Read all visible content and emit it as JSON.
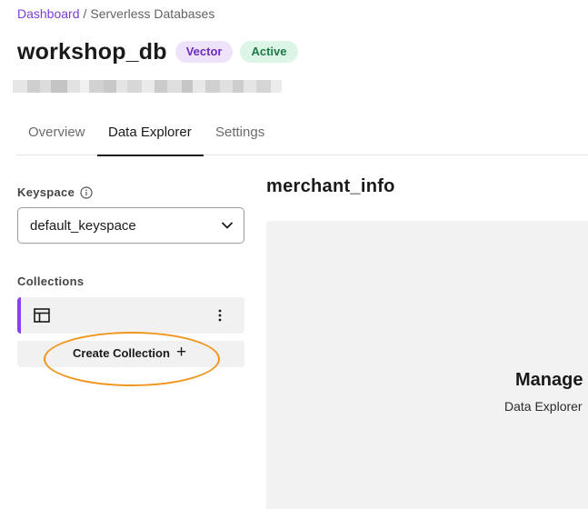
{
  "breadcrumb": {
    "link": "Dashboard",
    "separator": "/",
    "current": "Serverless Databases"
  },
  "database": {
    "name": "workshop_db",
    "badges": {
      "vector": "Vector",
      "active": "Active"
    }
  },
  "tabs": [
    {
      "label": "Overview"
    },
    {
      "label": "Data Explorer",
      "selected": true
    },
    {
      "label": "Settings"
    }
  ],
  "sidebar": {
    "keyspace_label": "Keyspace",
    "keyspace_value": "default_keyspace",
    "collections_label": "Collections",
    "create_collection_label": "Create Collection",
    "create_collection_icon": "+"
  },
  "main": {
    "title": "merchant_info",
    "panel_heading": "Manage",
    "panel_subtext": "Data Explorer"
  },
  "colors": {
    "accent": "#8a3ffc",
    "link": "#7b3fd4",
    "highlight": "#f0961e",
    "vector_badge_bg": "#efe3fb",
    "active_badge_bg": "#dcf5e6"
  }
}
